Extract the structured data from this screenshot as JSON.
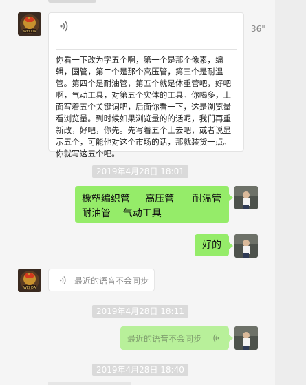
{
  "chat": {
    "incoming_voice_transcript": {
      "duration": "36\"",
      "text": "你看一下改为字五个啊，第一个是那个像素，编辑，圆管，第二个是那个高压管，第三个是耐温管。第四个是耐油管，第五个就是体重管吧，好吧啊，气动工具，对第五个实体的工具。你喝多，上面写着五个关键词吧，后面你看一下，这是浏览量看浏览量。到时候如果浏览量的的话呢，我们再重新改，好吧，你先。先写着五个上去吧，或者说显示五个，可能他对这个市场的话，那就装货一点。你就写这五个吧。"
    },
    "timestamps": [
      "2019年4月28日  18:01",
      "2019年4月28日  18:11",
      "2019年4月28日  18:40"
    ],
    "outgoing_messages": {
      "products_line1": "橡塑编织管     高压管      耐温管",
      "products_line2": "耐油管    气动工具",
      "reply": "好的"
    },
    "incoming_voice_notice": "最近的语音不会同步",
    "outgoing_voice_notice": "最近的语音不会同步",
    "avatar_left_text": "WEI DA"
  },
  "colors": {
    "bubble_outgoing": "#95ec69",
    "bubble_outgoing_faded": "#b8f09a",
    "timestamp_bg": "#dadada",
    "background": "#f5f5f5"
  }
}
